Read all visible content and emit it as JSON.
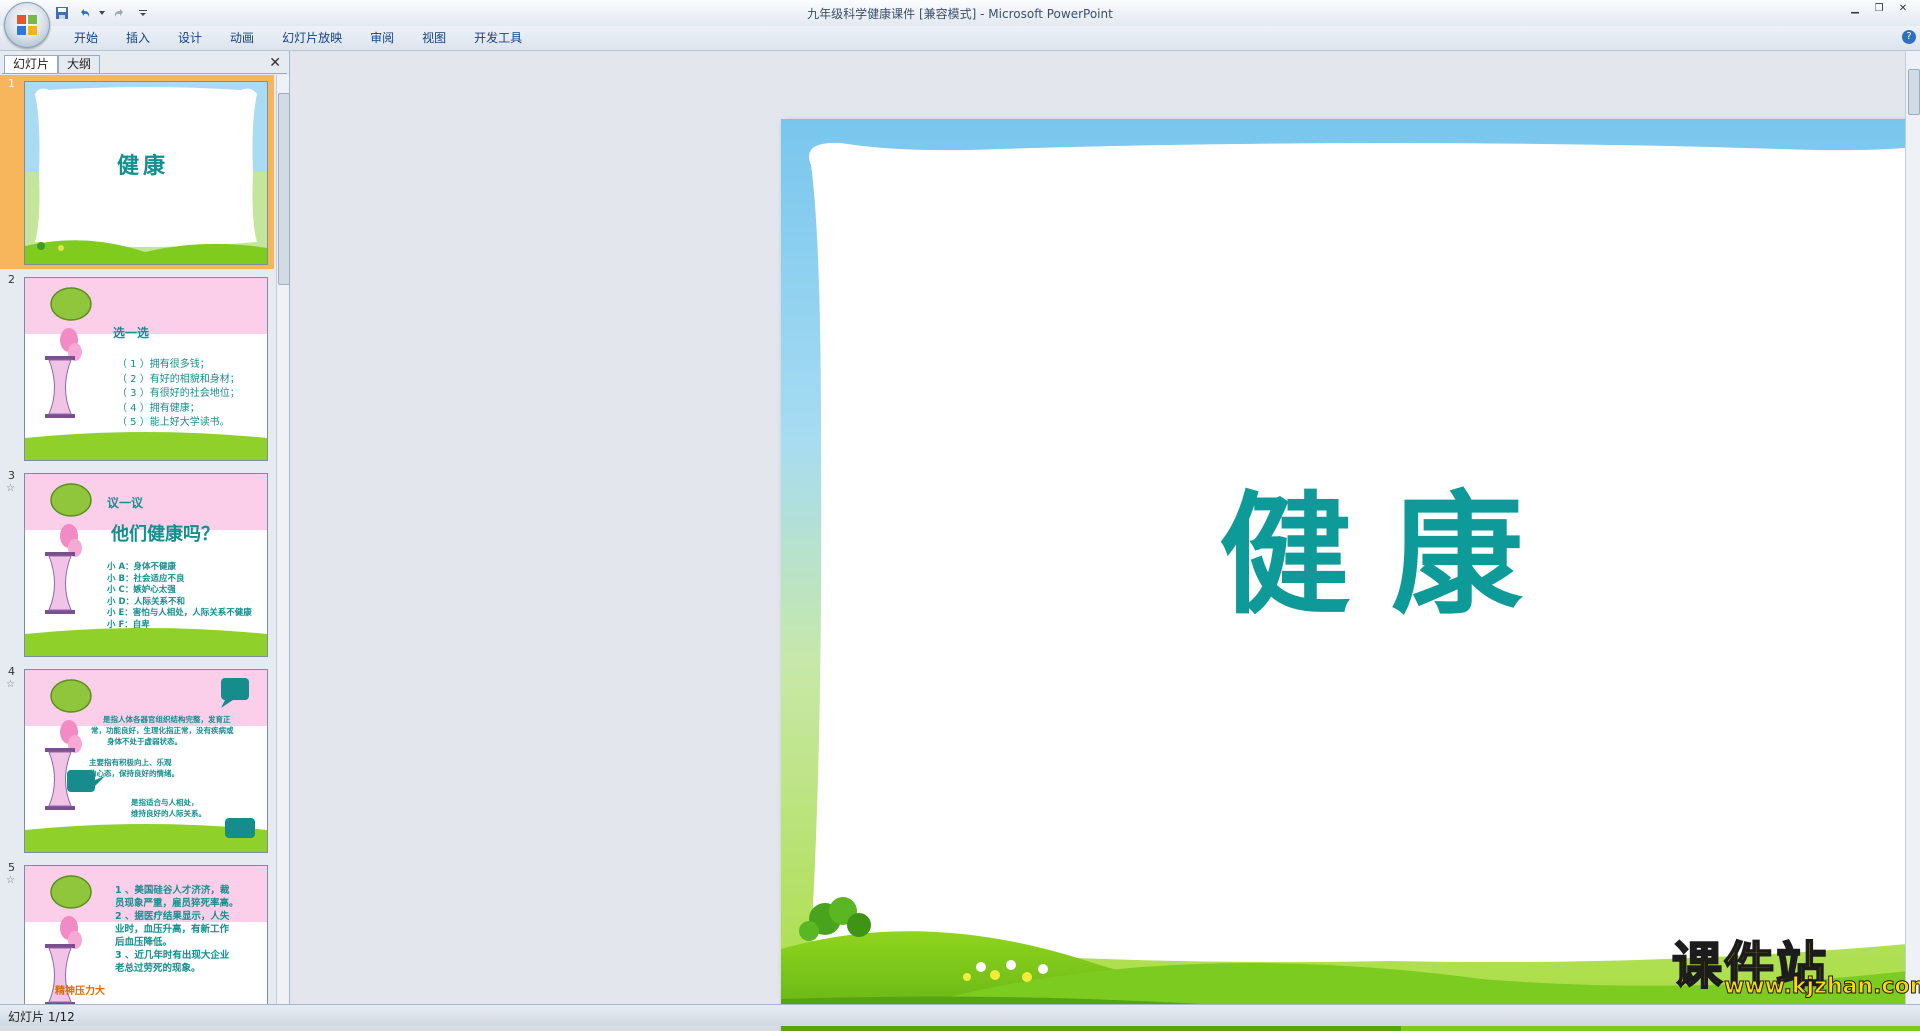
{
  "titlebar": {
    "title": "九年级科学健康课件 [兼容模式] - Microsoft PowerPoint"
  },
  "ribbon": {
    "tabs": [
      "开始",
      "插入",
      "设计",
      "动画",
      "幻灯片放映",
      "审阅",
      "视图",
      "开发工具"
    ]
  },
  "left_pane": {
    "tabs": [
      "幻灯片",
      "大纲"
    ],
    "slides": [
      {
        "number": "1",
        "title": "健康"
      },
      {
        "number": "2",
        "title": "选一选",
        "lines": [
          "（ 1 ）拥有很多钱；",
          "（ 2 ）有好的相貌和身材；",
          "（ 3 ）有很好的社会地位；",
          "（ 4 ）拥有健康；",
          "（ 5 ）能上好大学读书。"
        ]
      },
      {
        "number": "3",
        "subtitle": "议一议",
        "title": "他们健康吗？",
        "lines": [
          "小 A：身体不健康",
          "小 B：社会适应不良",
          "小 C：嫉妒心太强",
          "小 D：人际关系不和",
          "小 E：害怕与人相处，人际关系不健康",
          "小 F：自卑"
        ]
      },
      {
        "number": "4",
        "lines": [
          "是指人体各器官组织结构完整，发育正",
          "常，功能良好，生理化指正常，没有疾病或",
          "身体不处于虚弱状态。",
          "主要指有积极向上、乐观",
          "的心态，保持良好的情绪。",
          "是指适合与人相处，",
          "维持良好的人际关系。"
        ]
      },
      {
        "number": "5",
        "lines": [
          "1 、美国硅谷人才济济，裁",
          "员现象严重，雇员猝死率高。",
          "2 、据医疗结果显示，人失",
          "业时，血压升高，有新工作",
          "后血压降低。",
          "3 、近几年时有出现大企业",
          "老总过劳死的现象。"
        ],
        "footer": "精神压力大"
      }
    ]
  },
  "slide": {
    "title": "健康"
  },
  "statusbar": {
    "text": "幻灯片 1/12"
  },
  "watermark": {
    "main": "课件站",
    "sub": "www.kjzhan.com"
  },
  "colors": {
    "title_teal": "#0e9a99",
    "selection_orange": "#f7b65c",
    "ribbon_text": "#15428b"
  }
}
